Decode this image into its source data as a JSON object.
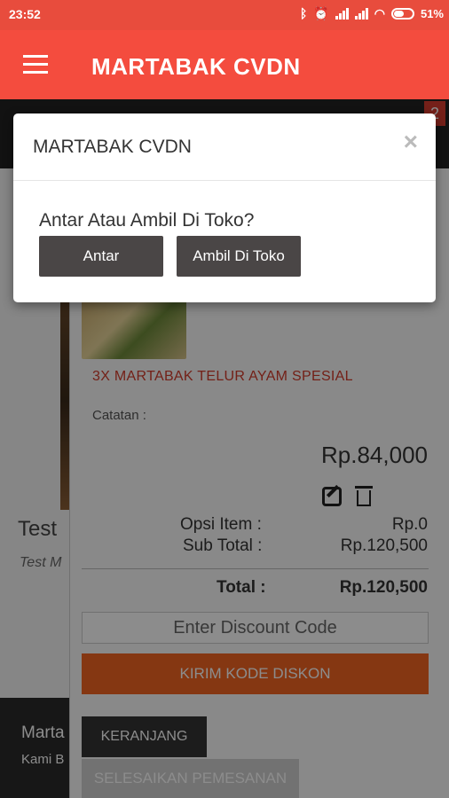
{
  "status_bar": {
    "time": "23:52",
    "icons": [
      "bluetooth-icon",
      "alarm-icon",
      "signal-icon",
      "signal-icon",
      "wifi-icon",
      "battery-icon"
    ],
    "battery": "51%"
  },
  "app_bar": {
    "title": "MARTABAK CVDN",
    "menu_icon": "hamburger-menu-icon"
  },
  "cart_badge": "2",
  "product": {
    "name": "Test",
    "subtitle": "Test M"
  },
  "footer_left": {
    "title": "Marta",
    "subtitle": "Kami B"
  },
  "cart": {
    "item_name": "3X MARTABAK TELUR AYAM SPESIAL",
    "note_label": "Catatan :",
    "price": "Rp.84,000",
    "option_label": "Opsi Item :",
    "option_value": "Rp.0",
    "subtotal_label": "Sub Total :",
    "subtotal_value": "Rp.120,500",
    "total_label": "Total :",
    "total_value": "Rp.120,500",
    "discount_placeholder": "Enter Discount Code",
    "discount_button": "KIRIM KODE DISKON",
    "cart_button": "KERANJANG",
    "finish_button": "SELESAIKAN PEMESANAN"
  },
  "dialog": {
    "title": "MARTABAK CVDN",
    "close_symbol": "×",
    "question": "Antar Atau Ambil Di Toko?",
    "buttons": [
      "Antar",
      "Ambil Di Toko"
    ]
  },
  "colors": {
    "status_bar": "#e84c3d",
    "app_bar": "#f44c3e",
    "accent_orange": "#f26522",
    "item_red": "#d23b2a",
    "dialog_button": "#4a4646"
  }
}
